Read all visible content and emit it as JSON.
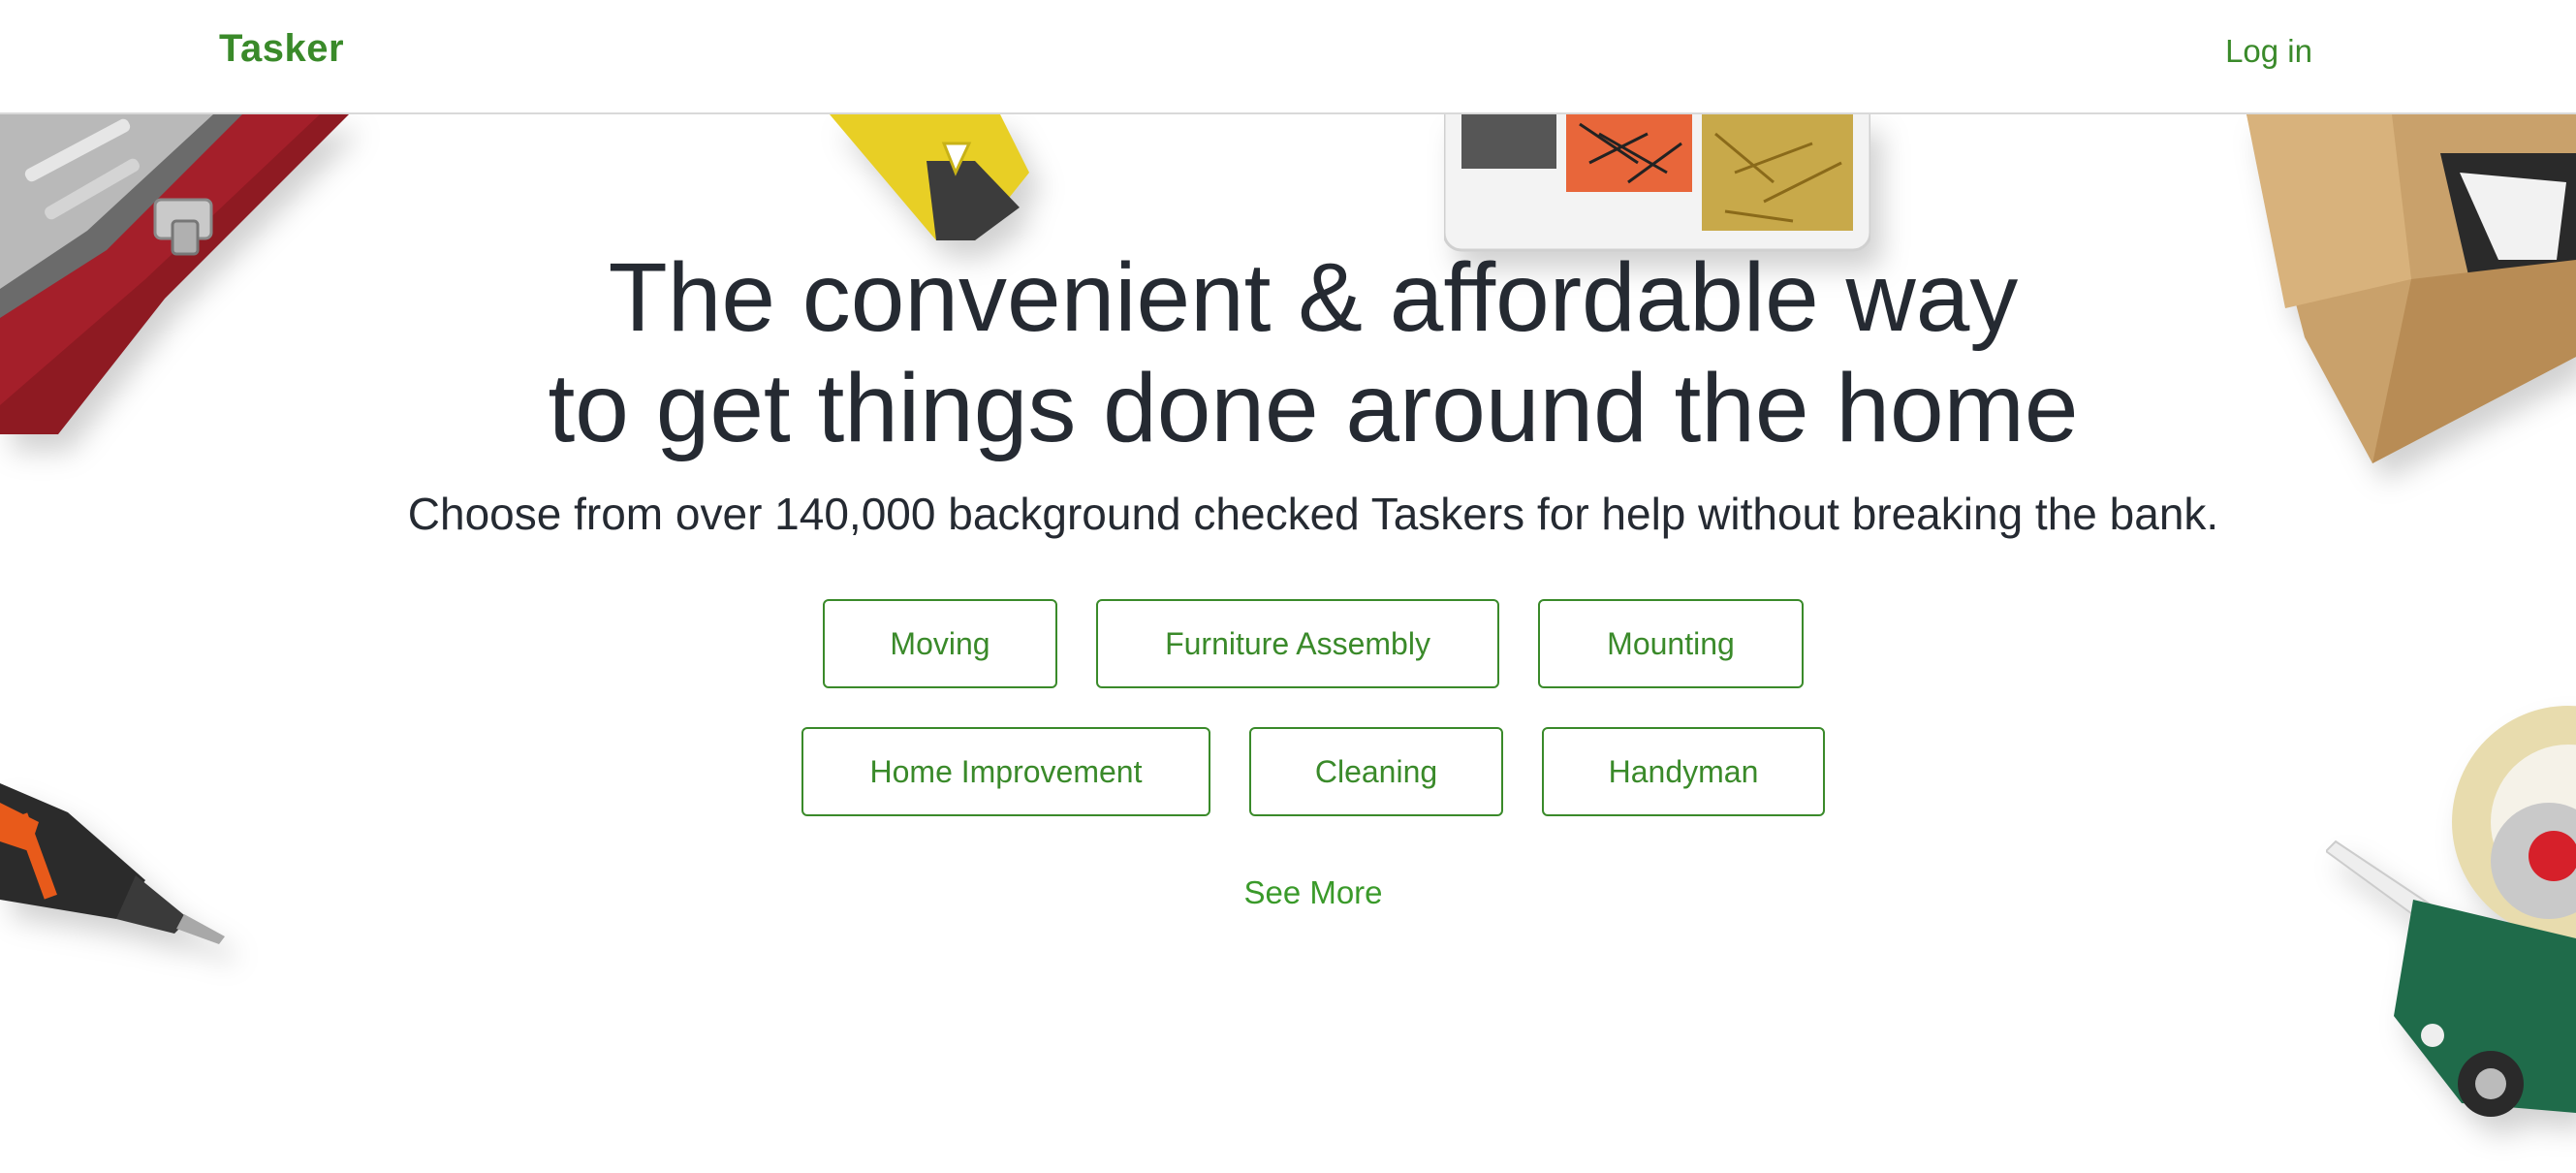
{
  "header": {
    "logo": "Tasker",
    "login_label": "Log in"
  },
  "hero": {
    "headline_line1": "The convenient & affordable way",
    "headline_line2": "to get things done around the home",
    "subheadline": "Choose from over 140,000 background checked Taskers for help without breaking the bank.",
    "categories_row1": [
      "Moving",
      "Furniture Assembly",
      "Mounting"
    ],
    "categories_row2": [
      "Home Improvement",
      "Cleaning",
      "Handyman"
    ],
    "see_more_label": "See More"
  },
  "colors": {
    "brand_green": "#3a8a2a",
    "text_dark": "#252a32",
    "header_border": "#d9d9d9"
  },
  "decorations": [
    "toolbox-image",
    "level-tool-image",
    "screw-organizer-image",
    "cardboard-box-image",
    "power-drill-image",
    "tape-dispenser-image"
  ]
}
